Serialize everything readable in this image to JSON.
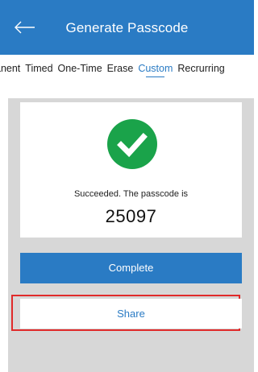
{
  "header": {
    "title": "Generate Passcode",
    "back_icon": "arrow-left-icon",
    "background": "#2a7bc4"
  },
  "tabs": [
    {
      "label": "anent",
      "active": false
    },
    {
      "label": "Timed",
      "active": false
    },
    {
      "label": "One-Time",
      "active": false
    },
    {
      "label": "Erase",
      "active": false
    },
    {
      "label": "Custom",
      "active": true
    },
    {
      "label": "Recrurring",
      "active": false
    }
  ],
  "result": {
    "icon": "check-circle-icon",
    "icon_color": "#1aa34a",
    "message": "Succeeded. The passcode is",
    "passcode": "25097"
  },
  "actions": {
    "complete_label": "Complete",
    "share_label": "Share"
  },
  "colors": {
    "accent": "#2a7bc4",
    "highlight": "#e02a2a",
    "panel_background": "#d7d7d7"
  }
}
